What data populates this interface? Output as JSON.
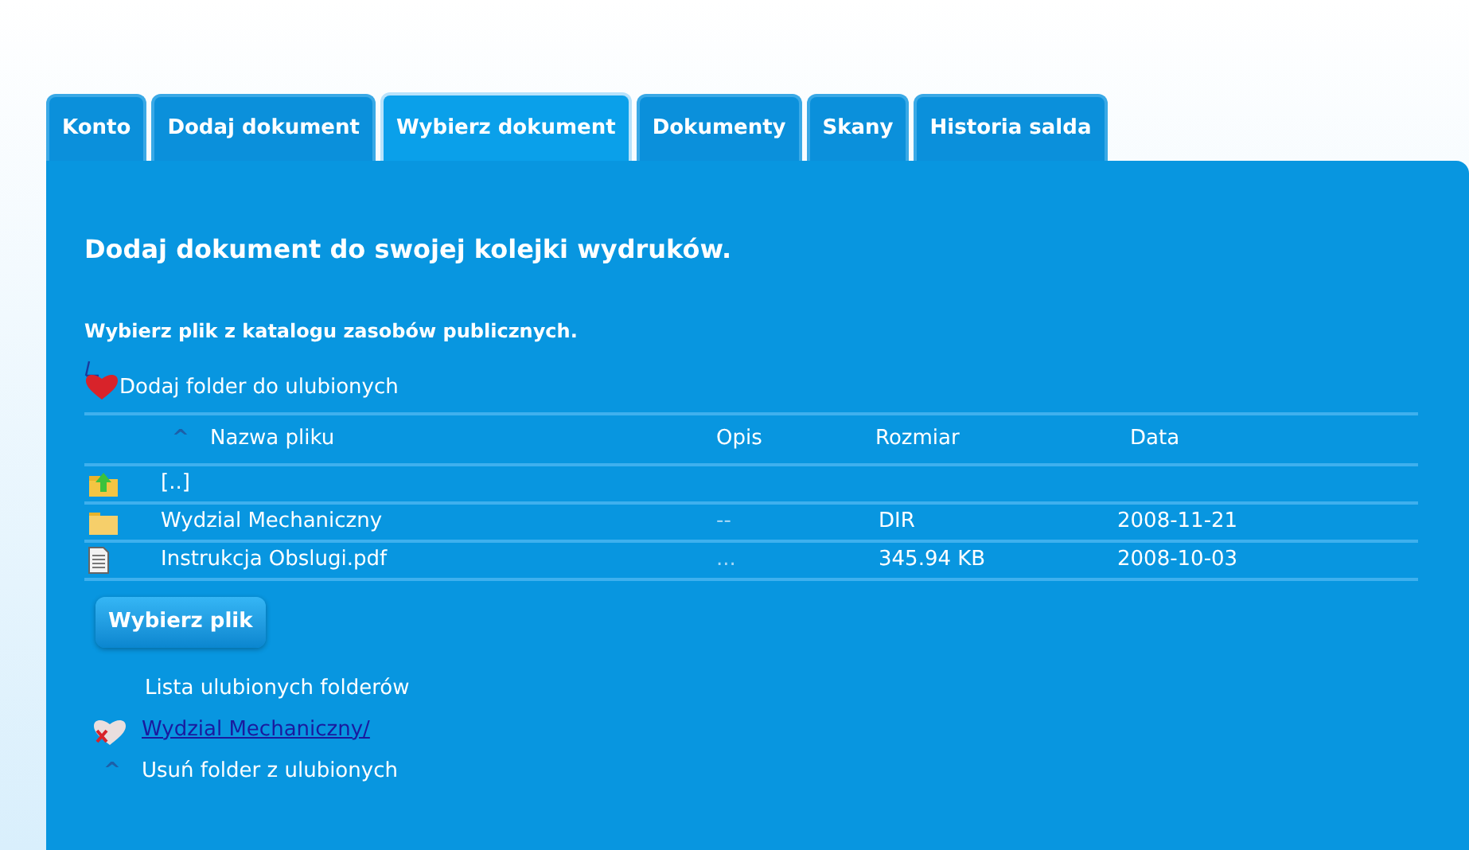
{
  "tabs": [
    {
      "label": "Konto",
      "selected": false
    },
    {
      "label": "Dodaj dokument",
      "selected": false
    },
    {
      "label": "Wybierz dokument",
      "selected": true
    },
    {
      "label": "Dokumenty",
      "selected": false
    },
    {
      "label": "Skany",
      "selected": false
    },
    {
      "label": "Historia salda",
      "selected": false
    }
  ],
  "heading": "Dodaj dokument do swojej kolejki wydruków.",
  "subheading": "Wybierz plik z katalogu zasobów publicznych.",
  "add_favorite": "Dodaj folder do ulubionych",
  "table": {
    "sort_indicator": "^",
    "columns": [
      "Nazwa pliku",
      "Opis",
      "Rozmiar",
      "Data"
    ],
    "rows": [
      {
        "kind": "up",
        "name": "[..]",
        "description": "",
        "size": "",
        "date": ""
      },
      {
        "kind": "folder",
        "name": "Wydzial Mechaniczny",
        "description": "--",
        "size": "DIR",
        "date": "2008-11-21"
      },
      {
        "kind": "file",
        "name": "Instrukcja Obslugi.pdf",
        "description": "...",
        "size": "345.94 KB",
        "date": "2008-10-03"
      }
    ]
  },
  "choose_button": "Wybierz plik",
  "favorites": {
    "title": "Lista ulubionych folderów",
    "items": [
      "Wydzial Mechaniczny/"
    ],
    "remove_indicator": "^",
    "remove": "Usuń folder z ulubionych"
  }
}
